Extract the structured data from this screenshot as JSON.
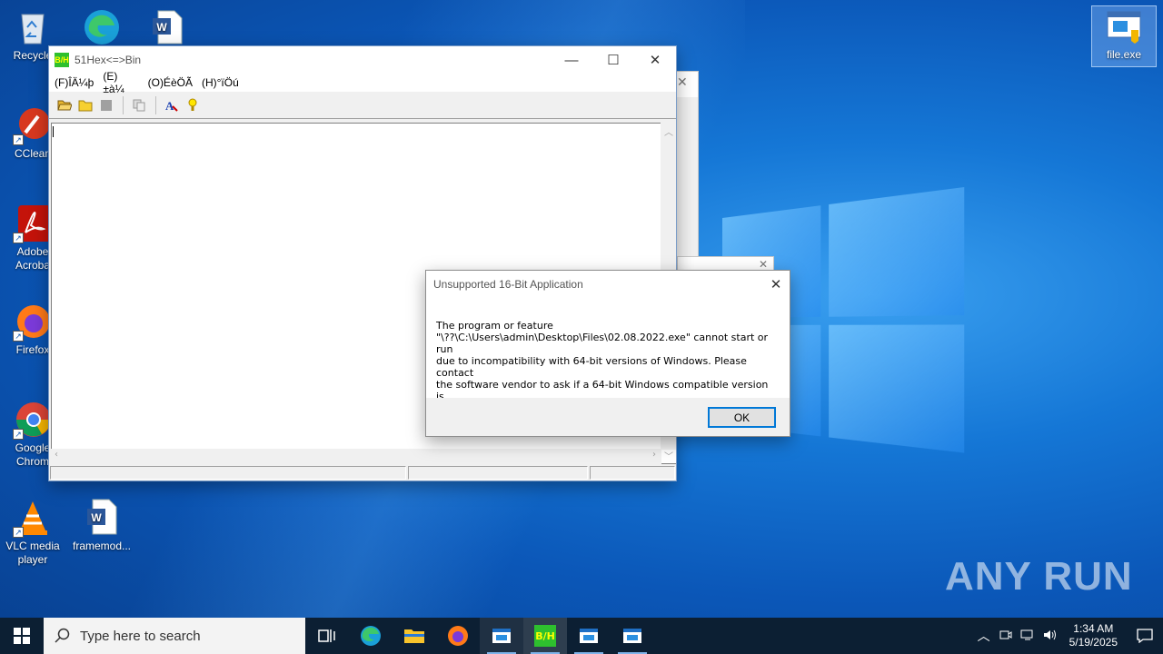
{
  "desktop": {
    "icons": [
      {
        "label": "Recycle",
        "icon": "recycle-bin-icon"
      },
      {
        "label": "",
        "icon": "edge-icon"
      },
      {
        "label": "",
        "icon": "word-doc-icon"
      },
      {
        "label": "CClean",
        "icon": "ccleaner-icon"
      },
      {
        "label": "Adobe\nAcroba",
        "icon": "acrobat-icon"
      },
      {
        "label": "Firefox",
        "icon": "firefox-icon"
      },
      {
        "label": "Google\nChrom",
        "icon": "chrome-icon"
      },
      {
        "label": "VLC media\nplayer",
        "icon": "vlc-icon"
      },
      {
        "label": "framemod...",
        "icon": "word-doc-icon"
      },
      {
        "label": "file.exe",
        "icon": "exe-file-icon"
      }
    ],
    "watermark": "ANY RUN"
  },
  "app": {
    "title": "51Hex<=>Bin",
    "icon_text": "B/H",
    "menu": [
      "(F)ÎÄ¼þ",
      "(E)±à¼­",
      "(O)ÉèÖÃ",
      "(H)°ïÖú"
    ],
    "toolbar": [
      "open-folder-icon",
      "folder-icon",
      "stop-icon",
      "copy-icon",
      "font-icon",
      "help-bulb-icon"
    ]
  },
  "dialog": {
    "title": "Unsupported 16-Bit Application",
    "message": "The program or feature\n\"\\??\\C:\\Users\\admin\\Desktop\\Files\\02.08.2022.exe\" cannot start or run\ndue to incompatibility with 64-bit versions of Windows. Please contact\nthe software vendor to ask if a 64-bit Windows compatible version is\navailable.",
    "ok_label": "OK"
  },
  "taskbar": {
    "search_placeholder": "Type here to search",
    "time": "1:34 AM",
    "date": "5/19/2025",
    "colors": {
      "background": "#0c1f33",
      "accent": "#0078d7"
    }
  }
}
